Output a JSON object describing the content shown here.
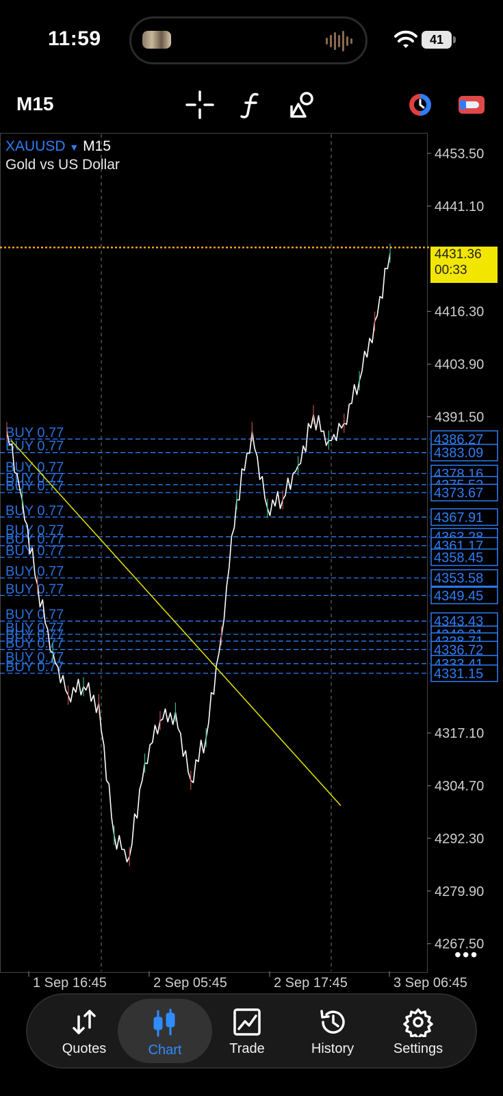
{
  "status_bar": {
    "time": "11:59",
    "battery": "41"
  },
  "toolbar": {
    "timeframe": "M15",
    "icons": [
      "crosshair-icon",
      "function-icon",
      "objects-icon",
      "account-icon",
      "toggle-icon"
    ]
  },
  "chart": {
    "symbol": "XAUUSD",
    "timeframe": "M15",
    "description": "Gold vs US Dollar",
    "current_price": "4431.36",
    "countdown": "00:33",
    "more_label": "•••",
    "y_ticks": [
      "4453.50",
      "4441.10",
      "4416.30",
      "4403.90",
      "4391.50",
      "4317.10",
      "4304.70",
      "4292.30",
      "4279.90",
      "4267.50"
    ],
    "x_ticks": [
      "1 Sep 16:45",
      "2 Sep 05:45",
      "2 Sep 17:45",
      "3 Sep 06:45"
    ],
    "order_labels": [
      "4386.27",
      "4383.09",
      "4378.16",
      "4375.52",
      "4373.67",
      "4367.91",
      "4363.28",
      "4361.17",
      "4358.45",
      "4353.58",
      "4349.45",
      "4343.43",
      "4340.31",
      "4338.71",
      "4336.72",
      "4333.41",
      "4331.15"
    ],
    "order_text": "BUY 0.77",
    "colors": {
      "order": "#2f7df6",
      "price_line": "#f0a030",
      "trendline": "#e6e600",
      "tag": "#f2e600"
    }
  },
  "chart_data": {
    "type": "line",
    "symbol": "XAUUSD",
    "ylim": [
      4261,
      4458
    ],
    "x": [
      "1 Sep 16:45",
      "2 Sep 05:45",
      "2 Sep 17:45",
      "3 Sep 06:45"
    ],
    "series": [
      {
        "values": [
          4388,
          4372,
          4352,
          4336,
          4326,
          4328,
          4324,
          4293,
          4288,
          4310,
          4320,
          4322,
          4306,
          4316,
          4340,
          4372,
          4388,
          4370,
          4372,
          4380,
          4392,
          4386,
          4390,
          4400,
          4414,
          4430
        ]
      }
    ]
  },
  "nav": {
    "items": [
      {
        "label": "Quotes"
      },
      {
        "label": "Chart"
      },
      {
        "label": "Trade"
      },
      {
        "label": "History"
      },
      {
        "label": "Settings"
      }
    ]
  }
}
